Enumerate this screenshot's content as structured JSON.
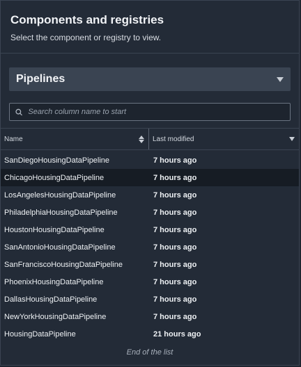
{
  "header": {
    "title": "Components and registries",
    "subtitle": "Select the component or registry to view."
  },
  "dropdown": {
    "selected": "Pipelines"
  },
  "search": {
    "placeholder": "Search column name to start"
  },
  "table": {
    "columns": {
      "name": "Name",
      "last_modified": "Last modified"
    },
    "rows": [
      {
        "name": "SanDiegoHousingDataPipeline",
        "modified": "7 hours ago"
      },
      {
        "name": "ChicagoHousingDataPipeline",
        "modified": "7 hours ago"
      },
      {
        "name": "LosAngelesHousingDataPipeline",
        "modified": "7 hours ago"
      },
      {
        "name": "PhiladelphiaHousingDataPipeline",
        "modified": "7 hours ago"
      },
      {
        "name": "HoustonHousingDataPipeline",
        "modified": "7 hours ago"
      },
      {
        "name": "SanAntonioHousingDataPipeline",
        "modified": "7 hours ago"
      },
      {
        "name": "SanFranciscoHousingDataPipeline",
        "modified": "7 hours ago"
      },
      {
        "name": "PhoenixHousingDataPipeline",
        "modified": "7 hours ago"
      },
      {
        "name": "DallasHousingDataPipeline",
        "modified": "7 hours ago"
      },
      {
        "name": "NewYorkHousingDataPipeline",
        "modified": "7 hours ago"
      },
      {
        "name": "HousingDataPipeline",
        "modified": "21 hours ago"
      }
    ],
    "end_text": "End of the list"
  }
}
